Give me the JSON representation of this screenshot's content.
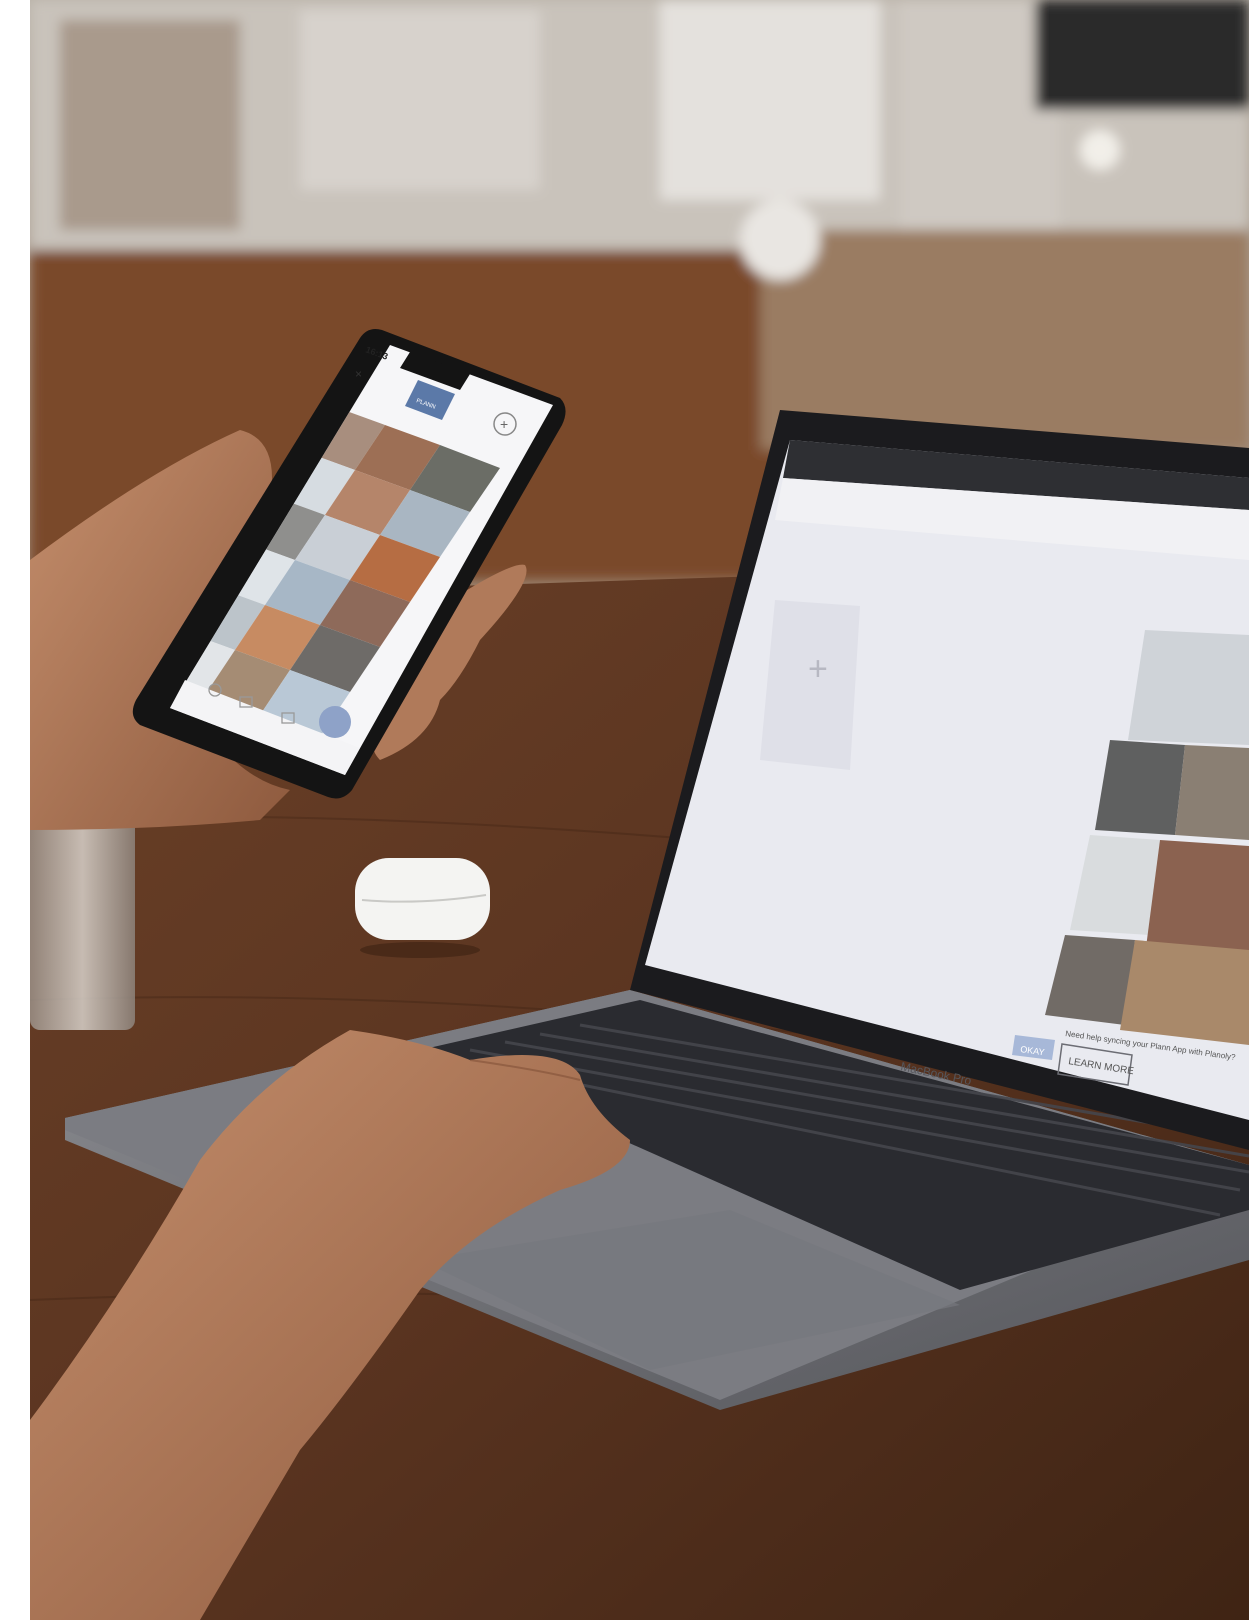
{
  "phone": {
    "status_time": "16:13",
    "app_logo_text": "PLANN",
    "close_icon": "close-icon",
    "add_icon": "plus-icon",
    "grid_photo_count": 18
  },
  "laptop": {
    "brand_text": "MacBook Pro",
    "learn_more_label": "LEARN MORE",
    "okay_label": "OKAY",
    "promo_text": "Need help syncing your Plann App with Planoly?",
    "add_icon": "plus-icon"
  },
  "colors": {
    "table": "#5a3a24",
    "laptop_body": "#6d6e73",
    "screen_bg": "#e9eaf0",
    "phone_frame": "#141414"
  }
}
